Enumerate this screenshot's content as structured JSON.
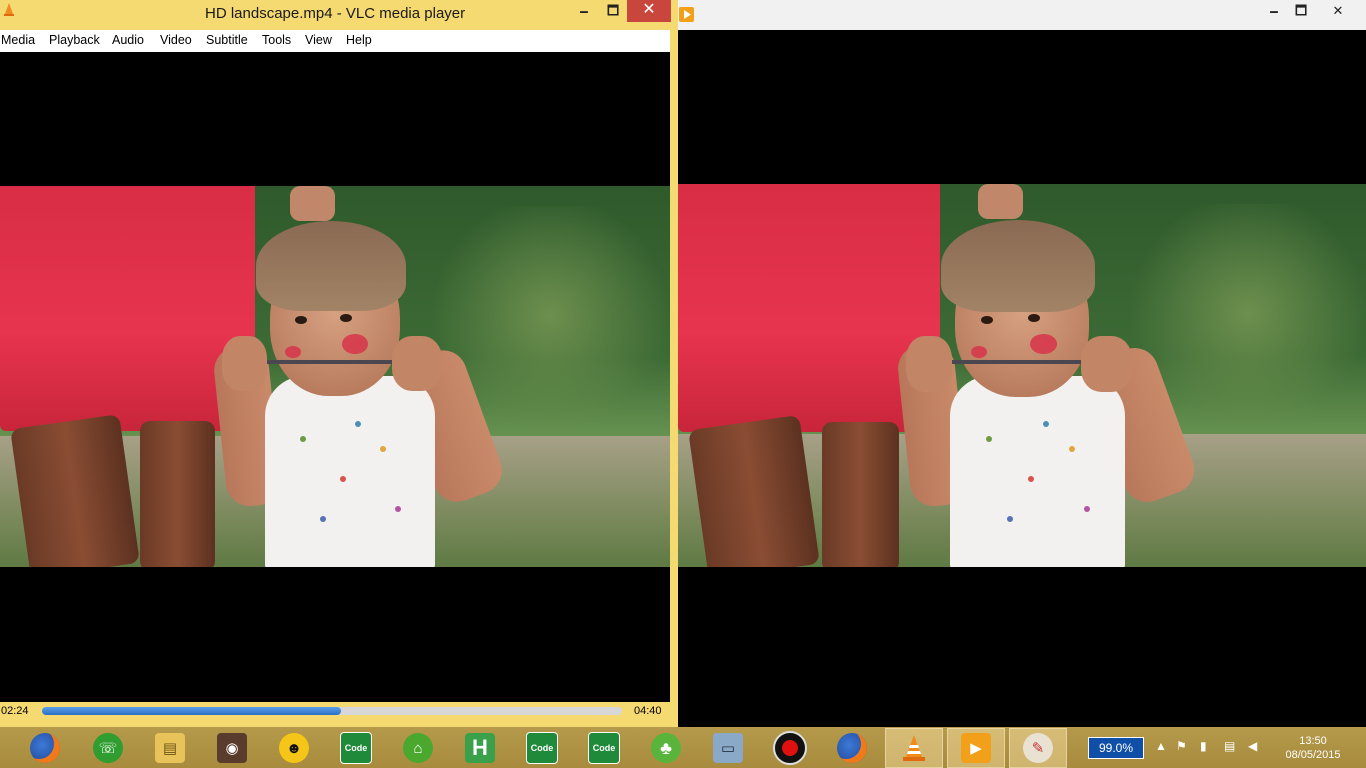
{
  "left_window": {
    "title": "HD landscape.mp4 - VLC media player",
    "minimize": "🗕",
    "maximize": "🗖",
    "close": "✕",
    "menu": [
      "Media",
      "Playback",
      "Audio",
      "Video",
      "Subtitle",
      "Tools",
      "View",
      "Help"
    ],
    "time_elapsed": "02:24",
    "time_total": "04:40",
    "progress": 0.515,
    "accent": "#f5d971"
  },
  "right_window": {
    "minimize": "🗕",
    "maximize": "🗖",
    "close": "✕"
  },
  "taskbar": {
    "apps": [
      {
        "name": "firefox"
      },
      {
        "name": "green-phone-app"
      },
      {
        "name": "file-explorer"
      },
      {
        "name": "speaker-app"
      },
      {
        "name": "sunglasses-smiley"
      },
      {
        "name": "code-app",
        "label": "Code"
      },
      {
        "name": "green-bag-app"
      },
      {
        "name": "h-app",
        "label": "H"
      },
      {
        "name": "code-app-2",
        "label": "Code"
      },
      {
        "name": "code-app-3",
        "label": "Code"
      },
      {
        "name": "clover-app"
      },
      {
        "name": "monitor-app"
      },
      {
        "name": "record-app"
      },
      {
        "name": "firefox-2"
      },
      {
        "name": "vlc-app"
      },
      {
        "name": "media-player-app"
      },
      {
        "name": "paint-app"
      }
    ],
    "battery": "99.0%",
    "time": "13:50",
    "date": "08/05/2015"
  }
}
